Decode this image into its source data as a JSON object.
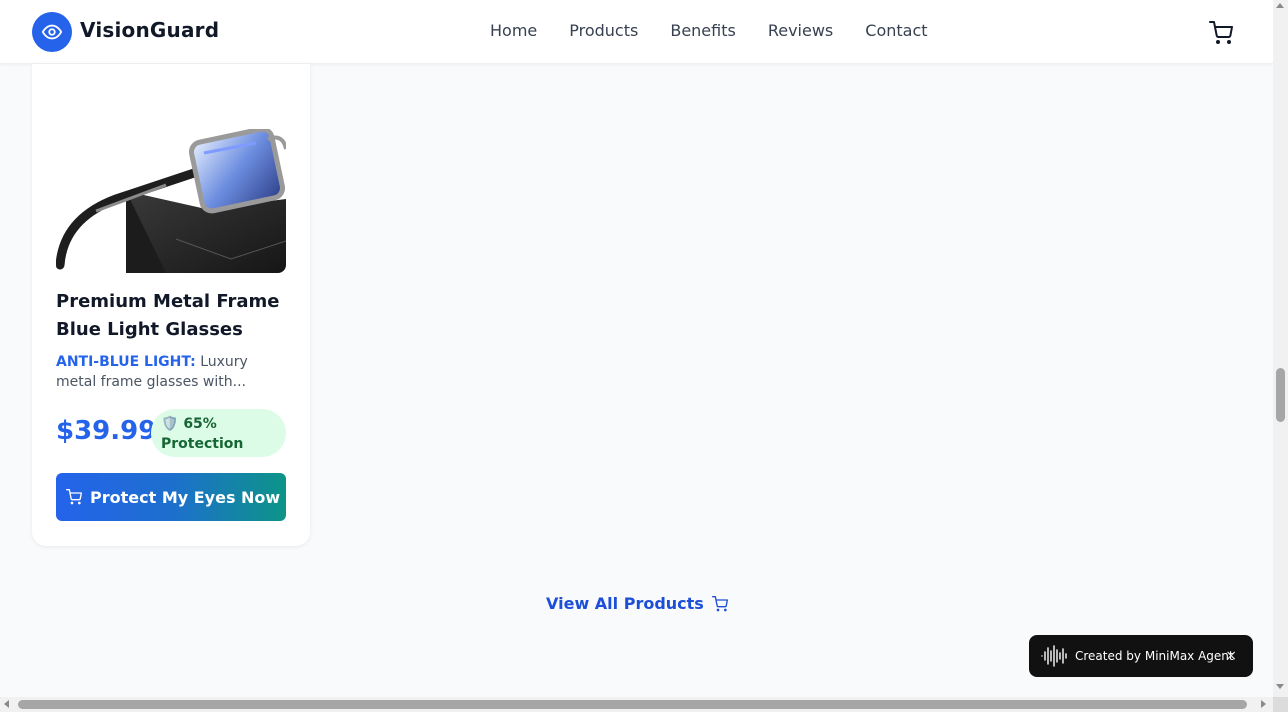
{
  "header": {
    "brand": "VisionGuard",
    "nav": [
      {
        "label": "Home"
      },
      {
        "label": "Products"
      },
      {
        "label": "Benefits"
      },
      {
        "label": "Reviews"
      },
      {
        "label": "Contact"
      }
    ],
    "cart_icon": "cart-icon",
    "logo_icon": "eye-icon"
  },
  "product": {
    "title": "Premium Metal Frame Blue Light Glasses",
    "tag": "ANTI-BLUE LIGHT:",
    "description": "Luxury metal frame glasses with...",
    "price": "$39.99",
    "protection_icon": "🛡️",
    "protection": "65% Protection",
    "cta": "Protect My Eyes Now",
    "image_alt": "glasses-on-case-image"
  },
  "view_all": {
    "label": "View All Products"
  },
  "agent_badge": {
    "label": "Created by MiniMax Agent",
    "close": "×"
  },
  "colors": {
    "accent": "#2563eb",
    "badge_bg": "#dcfce7",
    "badge_text": "#166534",
    "cta_gradient_end": "#0d9488"
  }
}
